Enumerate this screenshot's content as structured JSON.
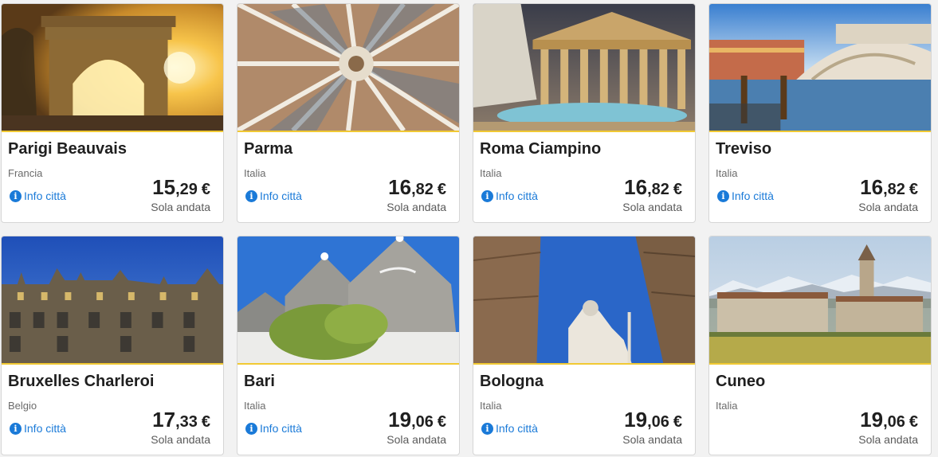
{
  "currency": "€",
  "colors": {
    "accent_border": "#f1c933",
    "link": "#1a7ad8",
    "text": "#1f1f1f",
    "muted": "#6b6b6b"
  },
  "info_icon": "info-circle-icon",
  "cards": [
    {
      "city": "Parigi Beauvais",
      "country": "Francia",
      "info": "Info città",
      "price_int": "15",
      "price_dec": ",29",
      "trip": "Sola andata",
      "image": "arc-de-triomphe"
    },
    {
      "city": "Parma",
      "country": "Italia",
      "info": "Info città",
      "price_int": "16",
      "price_dec": ",82",
      "trip": "Sola andata",
      "image": "dome-fresco"
    },
    {
      "city": "Roma Ciampino",
      "country": "Italia",
      "info": "Info città",
      "price_int": "16",
      "price_dec": ",82",
      "trip": "Sola andata",
      "image": "pantheon"
    },
    {
      "city": "Treviso",
      "country": "Italia",
      "info": "Info città",
      "price_int": "16",
      "price_dec": ",82",
      "trip": "Sola andata",
      "image": "rialto-bridge"
    },
    {
      "city": "Bruxelles Charleroi",
      "country": "Belgio",
      "info": "Info città",
      "price_int": "17",
      "price_dec": ",33",
      "trip": "Sola andata",
      "image": "grand-place"
    },
    {
      "city": "Bari",
      "country": "Italia",
      "info": "Info città",
      "price_int": "19",
      "price_dec": ",06",
      "trip": "Sola andata",
      "image": "trulli"
    },
    {
      "city": "Bologna",
      "country": "Italia",
      "info": "Info città",
      "price_int": "19",
      "price_dec": ",06",
      "trip": "Sola andata",
      "image": "towers-statue"
    },
    {
      "city": "Cuneo",
      "country": "Italia",
      "price_int": "19",
      "price_dec": ",06",
      "trip": "Sola andata",
      "image": "abbey-mountains"
    }
  ]
}
